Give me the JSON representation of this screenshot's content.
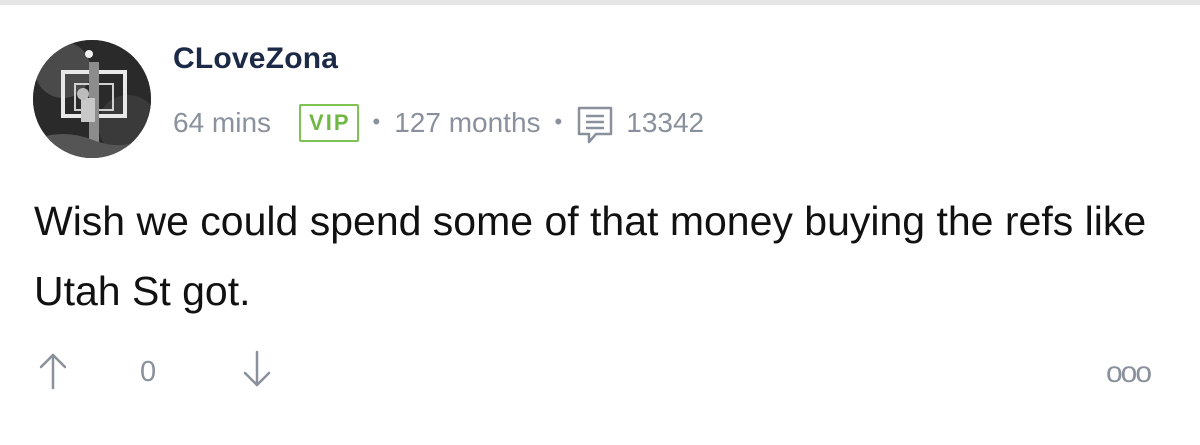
{
  "post": {
    "author": "CLoveZona",
    "time_ago": "64 mins",
    "badge": "VIP",
    "separator": "•",
    "tenure": "127 months",
    "post_count": "13342",
    "body": "Wish we could spend some of that money buying the refs like Utah St got."
  },
  "actions": {
    "upvote_icon": "arrow-up-icon",
    "vote_score": "0",
    "downvote_icon": "arrow-down-icon",
    "more_label": "ooo"
  },
  "icons": {
    "comment_count": "speech-bubble-icon"
  },
  "colors": {
    "author": "#1c2a48",
    "muted": "#8a919c",
    "vip_green": "#7dc252",
    "body_text": "#111111",
    "divider": "#e6e6e6"
  }
}
